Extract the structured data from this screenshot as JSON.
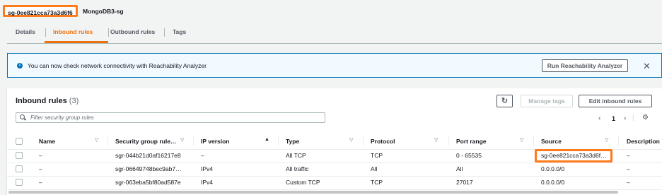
{
  "header": {
    "sg_id": "sg-0ee821cca73a3d6f6",
    "sg_name": "MongoDB3-sg"
  },
  "tabs": [
    {
      "label": "Details",
      "active": false
    },
    {
      "label": "Inbound rules",
      "active": true
    },
    {
      "label": "Outbound rules",
      "active": false
    },
    {
      "label": "Tags",
      "active": false
    }
  ],
  "banner": {
    "text": "You can now check network connectivity with Reachability Analyzer",
    "button": "Run Reachability Analyzer"
  },
  "panel": {
    "title": "Inbound rules",
    "count": "(3)",
    "manage_tags": "Manage tags",
    "edit_button": "Edit inbound rules",
    "search_placeholder": "Filter security group rules",
    "page": "1"
  },
  "columns": [
    "Name",
    "Security group rule…",
    "IP version",
    "Type",
    "Protocol",
    "Port range",
    "Source",
    "Description"
  ],
  "rows": [
    {
      "name": "–",
      "rule_id": "sgr-044b21d0af16217e8",
      "ip_version": "–",
      "type": "All TCP",
      "protocol": "TCP",
      "port_range": "0 - 65535",
      "source": "sg-0ee821cca73a3d6f…",
      "description": "–"
    },
    {
      "name": "–",
      "rule_id": "sgr-06649748bec9ab7…",
      "ip_version": "IPv4",
      "type": "All traffic",
      "protocol": "All",
      "port_range": "All",
      "source": "0.0.0.0/0",
      "description": "–"
    },
    {
      "name": "–",
      "rule_id": "sgr-063eba5bf80ad587e",
      "ip_version": "IPv4",
      "type": "Custom TCP",
      "protocol": "TCP",
      "port_range": "27017",
      "source": "0.0.0.0/0",
      "description": "–"
    }
  ],
  "colors": {
    "accent": "#ec7211",
    "highlight": "#ff7b1c",
    "info": "#0073bb"
  }
}
